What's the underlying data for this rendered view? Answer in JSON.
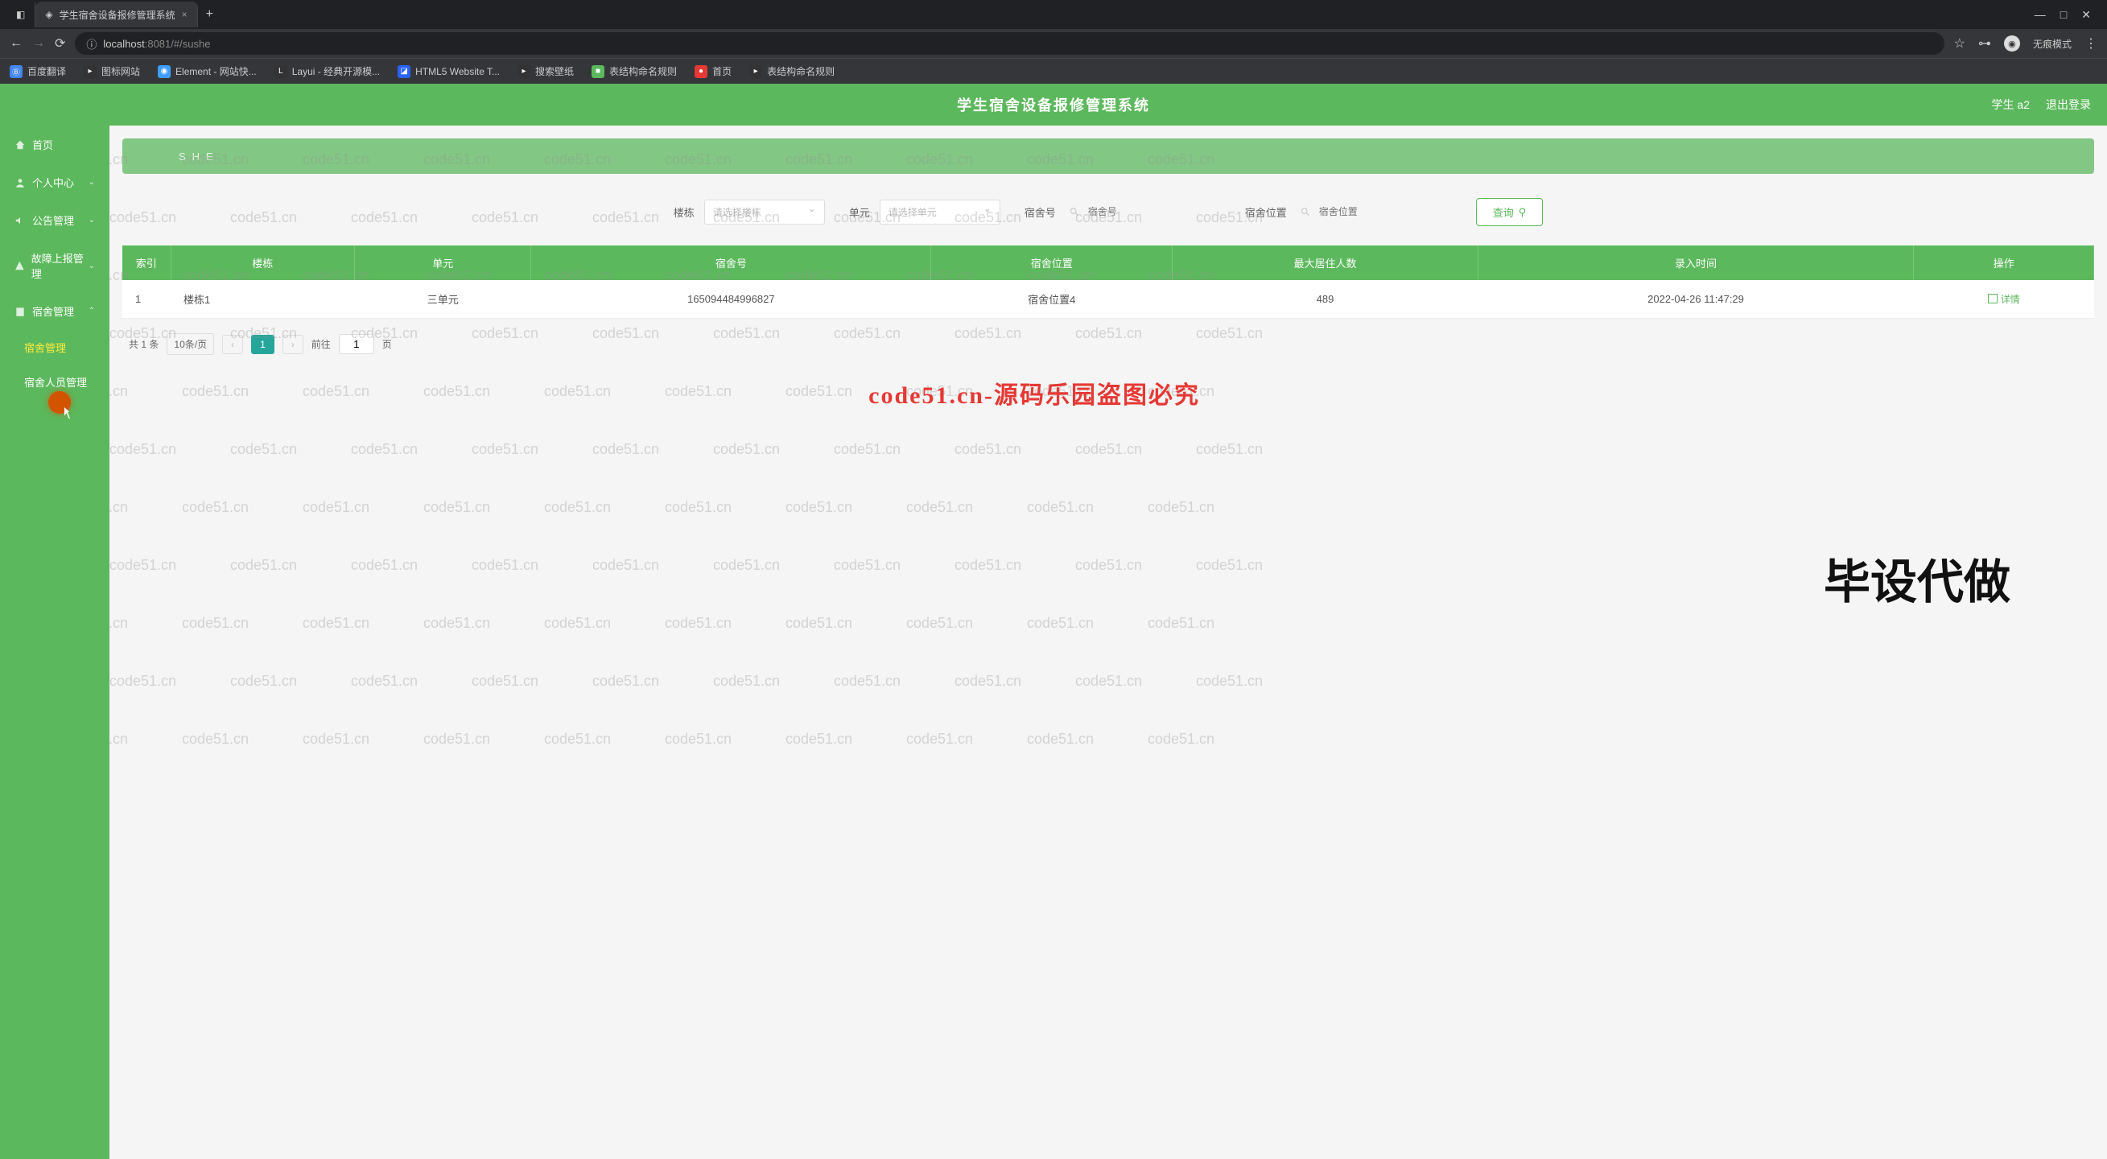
{
  "browser": {
    "tabs": [
      {
        "title": ""
      },
      {
        "title": "学生宿舍设备报修管理系统",
        "active": true
      }
    ],
    "url_prefix": "localhost",
    "url_port": ":8081",
    "url_path": "/#/sushe",
    "incognito_label": "无痕模式",
    "bookmarks": [
      {
        "label": "百度翻译",
        "color": "#4285f4"
      },
      {
        "label": "图标网站",
        "color": "#333"
      },
      {
        "label": "Element - 网站快...",
        "color": "#409eff"
      },
      {
        "label": "Layui - 经典开源模...",
        "color": "#333"
      },
      {
        "label": "HTML5 Website T...",
        "color": "#2962ff"
      },
      {
        "label": "搜索壁纸",
        "color": "#333"
      },
      {
        "label": "表结构命名规则",
        "color": "#5cb85c"
      },
      {
        "label": "首页",
        "color": "#e53935"
      },
      {
        "label": "表结构命名规则",
        "color": "#333"
      }
    ]
  },
  "header": {
    "title": "学生宿舍设备报修管理系统",
    "user_label": "学生 a2",
    "logout_label": "退出登录"
  },
  "sidebar": {
    "items": [
      {
        "label": "首页",
        "chevron": false
      },
      {
        "label": "个人中心",
        "chevron": true
      },
      {
        "label": "公告管理",
        "chevron": true
      },
      {
        "label": "故障上报管理",
        "chevron": true
      },
      {
        "label": "宿舍管理",
        "chevron": true,
        "expanded": true
      }
    ],
    "submenu": [
      {
        "label": "宿舍管理",
        "active": true
      },
      {
        "label": "宿舍人员管理",
        "active": false
      }
    ]
  },
  "banner": {
    "text": "SHE"
  },
  "filters": {
    "building_label": "楼栋",
    "building_placeholder": "请选择楼栋",
    "unit_label": "单元",
    "unit_placeholder": "请选择单元",
    "dorm_no_label": "宿舍号",
    "dorm_no_placeholder": "宿舍号",
    "location_label": "宿舍位置",
    "location_placeholder": "宿舍位置",
    "search_label": "查询"
  },
  "table": {
    "columns": [
      "索引",
      "楼栋",
      "单元",
      "宿舍号",
      "宿舍位置",
      "最大居住人数",
      "录入时间",
      "操作"
    ],
    "rows": [
      {
        "idx": "1",
        "building": "楼栋1",
        "unit": "三单元",
        "dorm_no": "165094484996827",
        "location": "宿舍位置4",
        "capacity": "489",
        "created": "2022-04-26 11:47:29"
      }
    ],
    "detail_label": "详情"
  },
  "pagination": {
    "total_prefix": "共",
    "total_count": "1",
    "total_suffix": "条",
    "page_size": "10条/页",
    "current": "1",
    "goto_prefix": "前往",
    "goto_value": "1",
    "goto_suffix": "页"
  },
  "watermarks": {
    "repeat": "code51.cn",
    "red": "code51.cn-源码乐园盗图必究",
    "big": "毕设代做"
  }
}
